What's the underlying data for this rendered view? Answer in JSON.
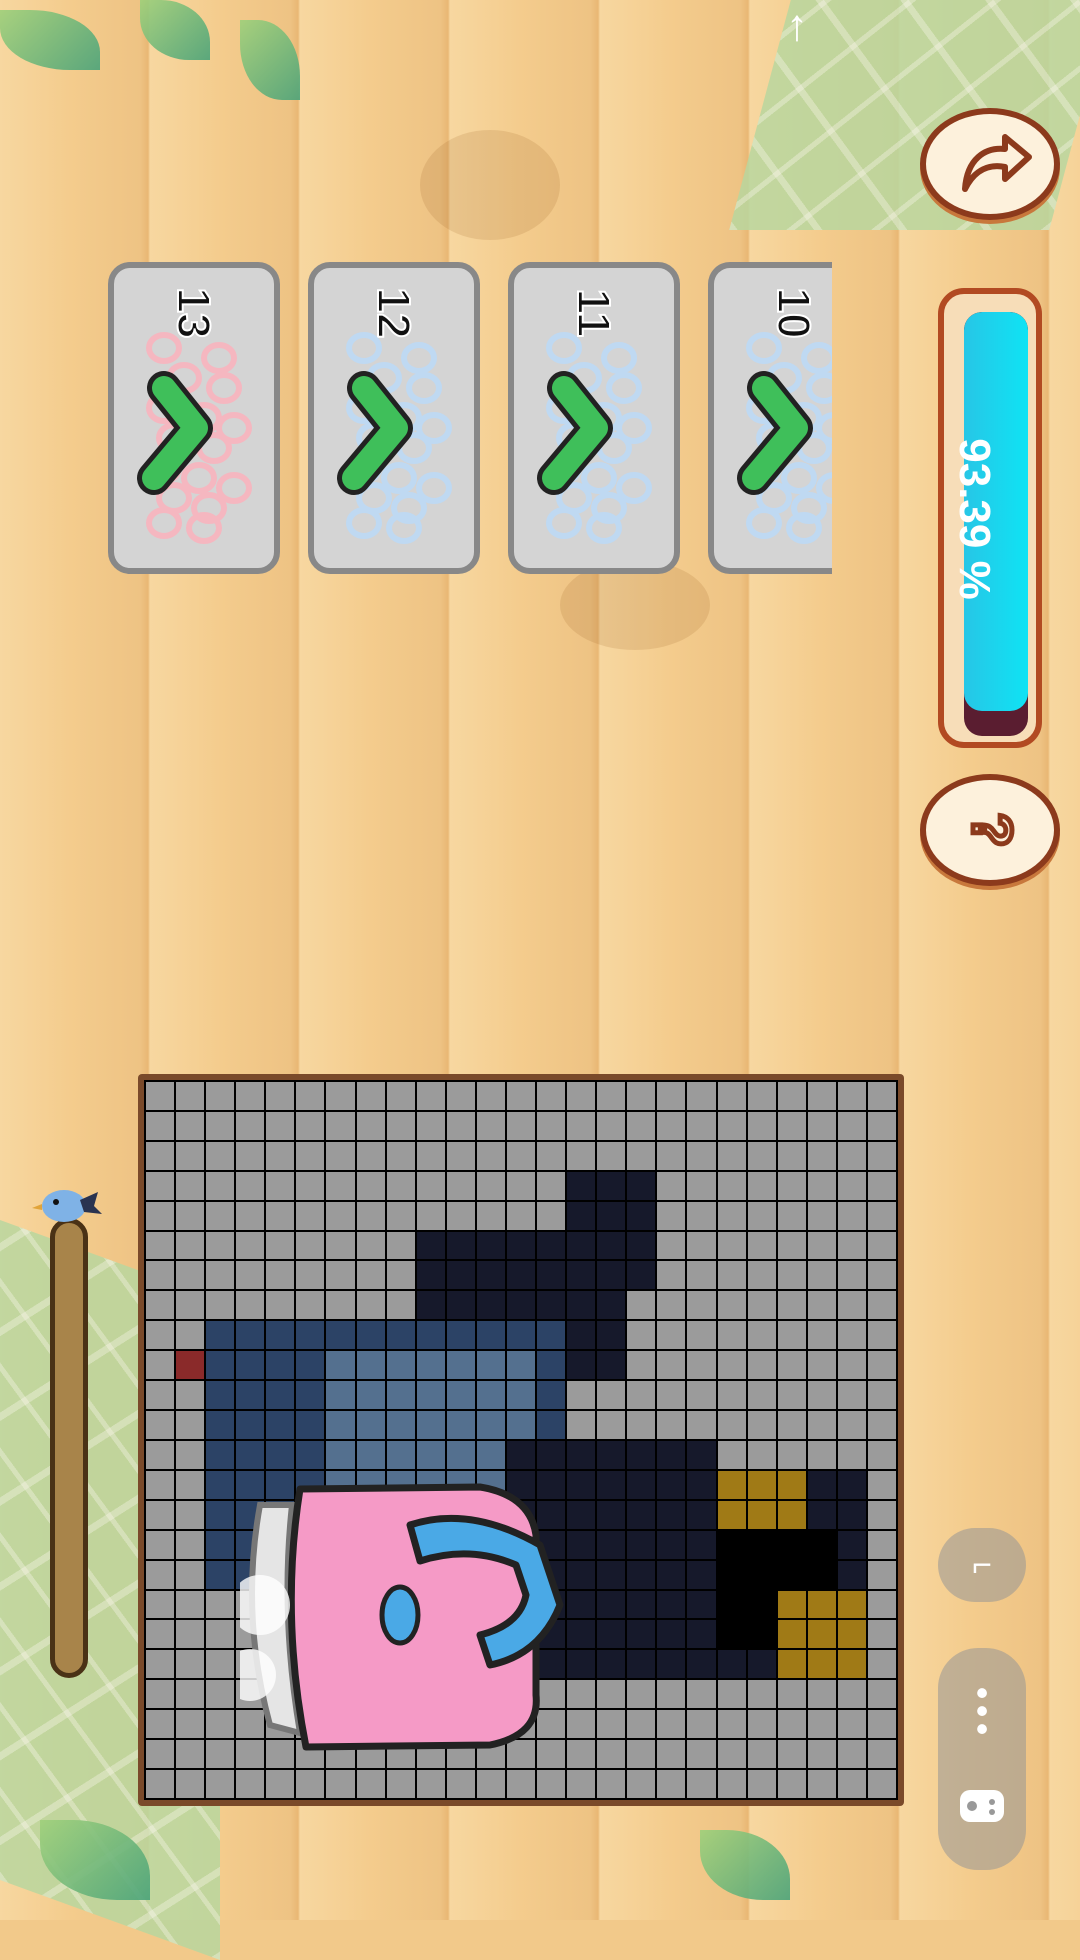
{
  "hud": {
    "progress_text": "93.39 %",
    "progress_fraction": 0.94,
    "share_label": "",
    "help_label": ""
  },
  "cards": [
    {
      "number": "13",
      "bead_color": "#f5b7c0",
      "completed": true
    },
    {
      "number": "12",
      "bead_color": "#bfd9f2",
      "completed": true
    },
    {
      "number": "11",
      "bead_color": "#bfd9f2",
      "completed": true
    },
    {
      "number": "10",
      "bead_color": "#bfd9f2",
      "completed": true
    }
  ],
  "colors": {
    "accent_bar": "#0fe3f4",
    "check": "#3fbf5a",
    "frame": "#8c3a1c"
  },
  "icons": {
    "top": "arrow-up-icon",
    "share": "share-arrow-icon",
    "help": "question-icon",
    "minimize": "minimize-icon",
    "more": "more-dots-icon",
    "gamepad": "gamepad-icon"
  }
}
